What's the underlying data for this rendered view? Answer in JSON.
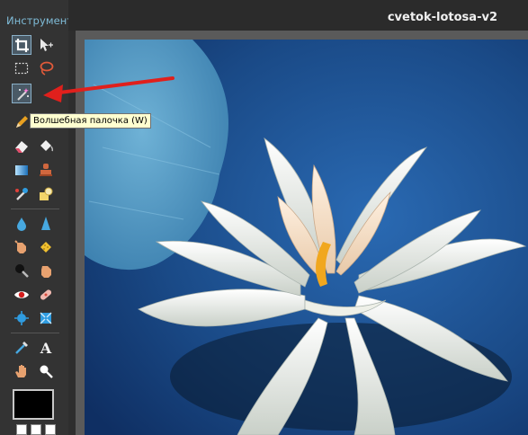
{
  "panel": {
    "title": "Инструмент",
    "tools": [
      {
        "name": "crop-icon",
        "selected": true
      },
      {
        "name": "move-icon",
        "selected": false
      },
      {
        "name": "marquee-icon",
        "selected": false
      },
      {
        "name": "lasso-icon",
        "selected": false
      },
      {
        "name": "magic-wand-icon",
        "selected": true
      },
      {
        "name": "pencil-icon",
        "selected": false
      },
      {
        "name": "brush-icon",
        "selected": false
      },
      {
        "name": "eraser-icon",
        "selected": false
      },
      {
        "name": "paint-bucket-icon",
        "selected": false
      },
      {
        "name": "gradient-icon",
        "selected": false
      },
      {
        "name": "clone-stamp-icon",
        "selected": false
      },
      {
        "name": "color-replace-icon",
        "selected": false
      },
      {
        "name": "shape-icon",
        "selected": false
      },
      {
        "name": "drop-icon",
        "selected": false
      },
      {
        "name": "sharpen-icon",
        "selected": false
      },
      {
        "name": "smudge-icon",
        "selected": false
      },
      {
        "name": "sponge-icon",
        "selected": false
      },
      {
        "name": "dodge-icon",
        "selected": false
      },
      {
        "name": "burn-icon",
        "selected": false
      },
      {
        "name": "red-eye-icon",
        "selected": false
      },
      {
        "name": "spot-heal-icon",
        "selected": false
      },
      {
        "name": "bloat-icon",
        "selected": false
      },
      {
        "name": "pinch-icon",
        "selected": false
      },
      {
        "name": "color-picker-icon",
        "selected": false
      },
      {
        "name": "text-icon",
        "selected": false
      },
      {
        "name": "hand-icon",
        "selected": false
      },
      {
        "name": "zoom-icon",
        "selected": false
      }
    ],
    "tooltip": "Волшебная палочка (W)",
    "foreground_color": "#000000",
    "background_color": "#ffffff"
  },
  "document": {
    "title": "cvetok-lotosa-v2"
  },
  "colors": {
    "accent": "#7fbcd8",
    "annotation_arrow": "#e0201c",
    "canvas_water": "#1d4c84"
  }
}
